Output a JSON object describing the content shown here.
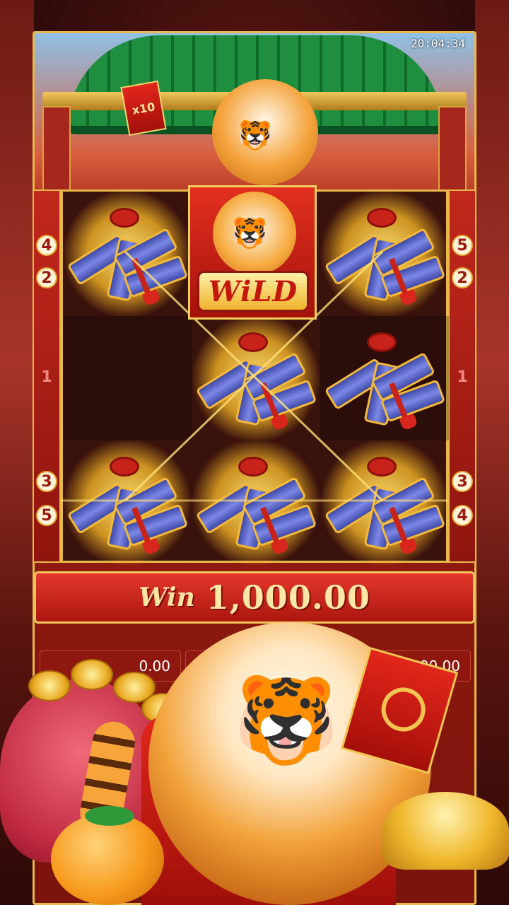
{
  "status_bar": {
    "time": "20:04:34"
  },
  "header": {
    "multiplier_badge": "x10"
  },
  "paylines": {
    "left_top": [
      "4",
      "2"
    ],
    "left_mid": "1",
    "left_bottom": [
      "3",
      "5"
    ],
    "right_top": [
      "5",
      "2"
    ],
    "right_mid": "1",
    "right_bottom": [
      "3",
      "4"
    ]
  },
  "reels": {
    "grid": [
      [
        "firecracker",
        "wild",
        "firecracker"
      ],
      [
        "empty",
        "firecracker",
        "firecracker"
      ],
      [
        "firecracker",
        "firecracker",
        "firecracker"
      ]
    ],
    "wild_label": "WiLD"
  },
  "win": {
    "label": "Win",
    "amount": "1,000.00"
  },
  "info_bars": {
    "left_value": "0.00",
    "right_value": "1,000.00"
  },
  "icons": {
    "symbol": "firecracker-icon",
    "wild": "tiger-wild-icon",
    "mascot": "fortune-tiger-icon"
  },
  "colors": {
    "frame_gold": "#e8b84a",
    "banner_red": "#e4372a",
    "roof_green": "#1f8f3f"
  }
}
